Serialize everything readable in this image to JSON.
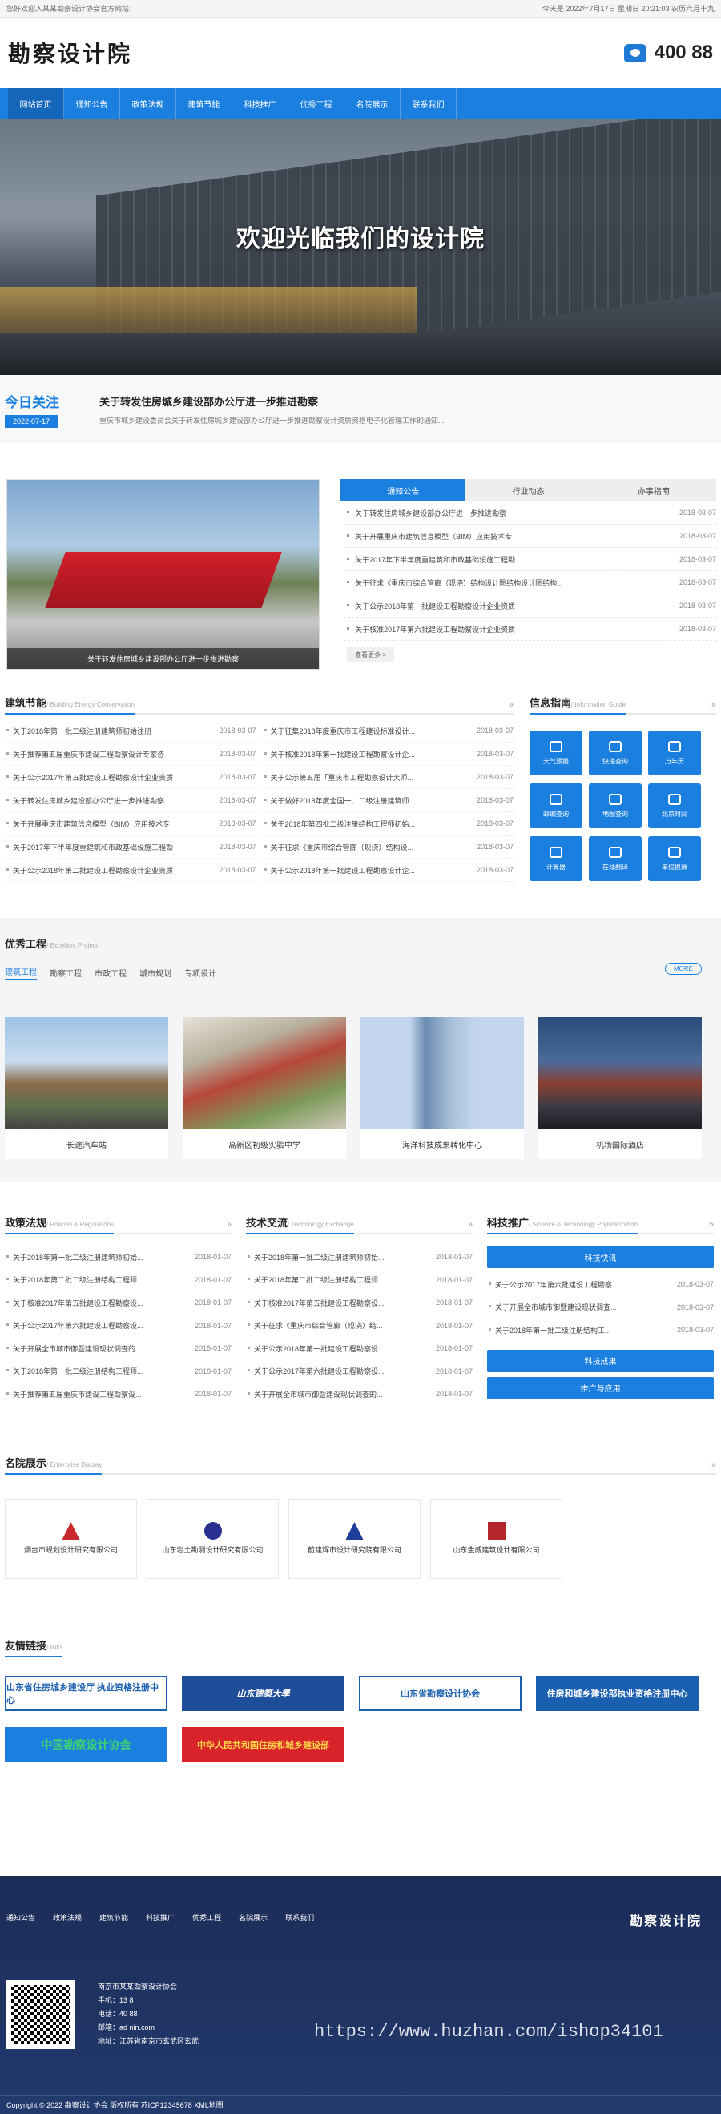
{
  "topbar": {
    "welcome": "您好欢迎入某某勘察设计协会官方网站！",
    "datetime": "今天是 2022年7月17日 星期日 20:21:03 农历六月十九"
  },
  "header": {
    "logo": "勘察设计院",
    "phone": "400 88"
  },
  "nav": [
    "网站首页",
    "通知公告",
    "政策法规",
    "建筑节能",
    "科技推广",
    "优秀工程",
    "名院展示",
    "联系我们"
  ],
  "banner": {
    "title": "欢迎光临我们的设计院"
  },
  "today": {
    "label": "今日关注",
    "date": "2022-07-17",
    "title": "关于转发住房城乡建设部办公厅进一步推进勘察",
    "desc": "重庆市城乡建设委员会关于转发住房城乡建设部办公厅进一步推进勘察设计资质资格电子化管理工作的通知..."
  },
  "feature": {
    "caption": "关于转发住房城乡建设部办公厅进一步推进勘察",
    "tabs": [
      "通知公告",
      "行业动态",
      "办事指南"
    ],
    "more": "查看更多 >",
    "news": [
      {
        "t": "关于转发住房城乡建设部办公厅进一步推进勘察",
        "d": "2018-03-07"
      },
      {
        "t": "关于开展重庆市建筑信息模型（BIM）应用技术专",
        "d": "2018-03-07"
      },
      {
        "t": "关于2017年下半年度重建筑和市政基础设施工程勘",
        "d": "2018-03-07"
      },
      {
        "t": "关于征求《重庆市综合管廊（现浇）结构设计图结构设计图结构...",
        "d": "2018-03-07"
      },
      {
        "t": "关于公示2018年第一批建设工程勘察设计企业资质",
        "d": "2018-03-07"
      },
      {
        "t": "关于核准2017年第六批建设工程勘察设计企业资质",
        "d": "2018-03-07"
      }
    ]
  },
  "energy": {
    "title": "建筑节能",
    "en": "/ Building Energy Conservation",
    "left": [
      {
        "t": "关于2018年第一批二级注册建筑师初始注册",
        "d": "2018-03-07"
      },
      {
        "t": "关于推荐第五届重庆市建设工程勘察设计专家咨",
        "d": "2018-03-07"
      },
      {
        "t": "关于公示2017年第五批建设工程勘察设计企业资质",
        "d": "2018-03-07"
      },
      {
        "t": "关于转发住房城乡建设部办公厅进一步推进勘察",
        "d": "2018-03-07"
      },
      {
        "t": "关于开展重庆市建筑信息模型（BIM）应用技术专",
        "d": "2018-03-07"
      },
      {
        "t": "关于2017年下半年度重建筑和市政基础设施工程勘",
        "d": "2018-03-07"
      },
      {
        "t": "关于公示2018年第二批建设工程勘察设计企业资质",
        "d": "2018-03-07"
      }
    ],
    "right": [
      {
        "t": "关于征集2018年度重庆市工程建设标准设计...",
        "d": "2018-03-07"
      },
      {
        "t": "关于核准2018年第一批建设工程勘察设计企...",
        "d": "2018-03-07"
      },
      {
        "t": "关于公示第五届「重庆市工程勘察设计大师...",
        "d": "2018-03-07"
      },
      {
        "t": "关于做好2018年度全国一、二级注册建筑师...",
        "d": "2018-03-07"
      },
      {
        "t": "关于2018年第四批二级注册结构工程师初始...",
        "d": "2018-03-07"
      },
      {
        "t": "关于征求《重庆市综合管廊（现浇）结构设...",
        "d": "2018-03-07"
      },
      {
        "t": "关于公示2018年第一批建设工程勘察设计企...",
        "d": "2018-03-07"
      }
    ]
  },
  "guide": {
    "title": "信息指南",
    "en": "/ Information Guide",
    "items": [
      "天气预报",
      "快递查询",
      "万年历",
      "邮编查询",
      "地图查询",
      "北京时间",
      "计算器",
      "在线翻译",
      "单位换算"
    ]
  },
  "projects": {
    "title": "优秀工程",
    "en": "/ Excellent Project",
    "tabs": [
      "建筑工程",
      "勘察工程",
      "市政工程",
      "城市规划",
      "专项设计"
    ],
    "more": "MORE",
    "cards": [
      "长途汽车站",
      "高新区初级实验中学",
      "海洋科技成果转化中心",
      "机场国际酒店"
    ]
  },
  "policy": {
    "title": "政策法规",
    "en": "/ Policies & Regulations",
    "items": [
      {
        "t": "关于2018年第一批二级注册建筑师初始...",
        "d": "2018-01-07"
      },
      {
        "t": "关于2018年第二批二级注册结构工程师...",
        "d": "2018-01-07"
      },
      {
        "t": "关于核准2017年第五批建设工程勘察设...",
        "d": "2018-01-07"
      },
      {
        "t": "关于公示2017年第六批建设工程勘察设...",
        "d": "2018-01-07"
      },
      {
        "t": "关于开展全市城市御暨建设现状调查的...",
        "d": "2018-01-07"
      },
      {
        "t": "关于2018年第一批二级注册结构工程师...",
        "d": "2018-01-07"
      },
      {
        "t": "关于推荐第五届重庆市建设工程勘察设...",
        "d": "2018-01-07"
      }
    ]
  },
  "tech": {
    "title": "技术交流",
    "en": "/ Technology Exchange",
    "items": [
      {
        "t": "关于2018年第一批二级注册建筑师初始...",
        "d": "2018-01-07"
      },
      {
        "t": "关于2018年第二批二级注册结构工程师...",
        "d": "2018-01-07"
      },
      {
        "t": "关于核准2017年第五批建设工程勘察设...",
        "d": "2018-01-07"
      },
      {
        "t": "关于征求《重庆市综合管廊（现浇）结...",
        "d": "2018-01-07"
      },
      {
        "t": "关于公示2018年第一批建设工程勘察设...",
        "d": "2018-01-07"
      },
      {
        "t": "关于公示2017年第六批建设工程勘察设...",
        "d": "2018-01-07"
      },
      {
        "t": "关于开展全市城市御暨建设现状调查的...",
        "d": "2018-01-07"
      }
    ]
  },
  "promo": {
    "title": "科技推广",
    "en": "/ Science & Technology Popularization",
    "btn1": "科技快讯",
    "btn2": "科技成果",
    "btn3": "推广与应用",
    "items": [
      {
        "t": "关于公示2017年第六批建设工程勘察...",
        "d": "2018-03-07"
      },
      {
        "t": "关于开展全市城市御暨建设现状调查...",
        "d": "2018-03-07"
      },
      {
        "t": "关于2018年第一批二级注册结构工...",
        "d": "2018-03-07"
      }
    ]
  },
  "famous": {
    "title": "名院展示",
    "en": "/ Enterprise Display",
    "logos": [
      "烟台市规划设计研究有限公司",
      "山东岩土勘测设计研究有限公司",
      "前建辉市设计研究院有限公司",
      "山东金威建筑设计有限公司"
    ]
  },
  "friends": {
    "title": "友情链接",
    "en": "/ links",
    "items": [
      "山东省住房城乡建设厅 执业资格注册中心",
      "山东建築大學",
      "山东省勘察设计协会",
      "住房和城乡建设部执业资格注册中心",
      "中国勘察设计协会",
      "中华人民共和国住房和城乡建设部"
    ]
  },
  "footer": {
    "nav": [
      "通知公告",
      "政策法规",
      "建筑节能",
      "科技推广",
      "优秀工程",
      "名院展示",
      "联系我们"
    ],
    "logo": "勘察设计院",
    "org": "南京市某某勘察设计协会",
    "mobile": "手机：13 8",
    "tel": "电话：40 88",
    "email": "邮箱：ad nin.com",
    "addr": "地址：江苏省南京市玄武区玄武",
    "copy": "Copyright © 2022 勘察设计协会 版权所有  苏ICP12345678  XML地图"
  },
  "watermark": "https://www.huzhan.com/ishop34101"
}
